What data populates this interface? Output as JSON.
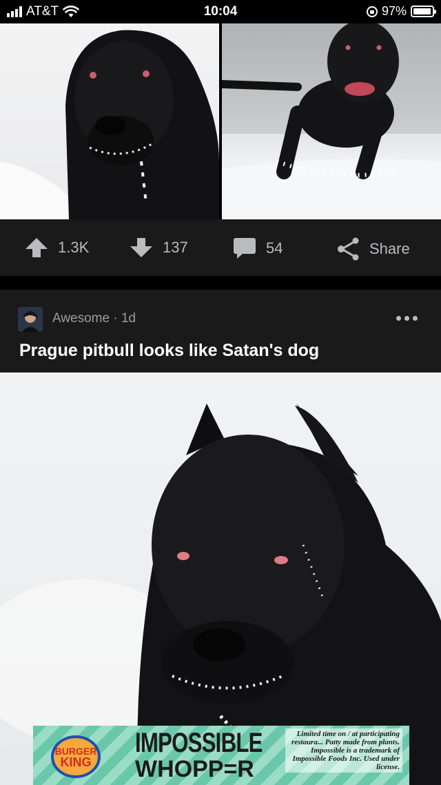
{
  "status_bar": {
    "carrier": "AT&T",
    "time": "10:04",
    "battery_percent": "97%",
    "battery_level": 0.97
  },
  "top_post": {
    "images": [
      "dog-closeup-in-snow",
      "dog-jumping-in-snow"
    ],
    "actions": {
      "upvotes": "1.3K",
      "downvotes": "137",
      "comments": "54",
      "share_label": "Share"
    }
  },
  "post": {
    "author": "Awesome",
    "age": "1d",
    "meta_separator": "·",
    "title": "Prague pitbull looks like Satan's dog",
    "image": "black-pitbull-in-snow"
  },
  "ad": {
    "brand": "BURGER KING",
    "brand_line1": "BURGER",
    "brand_line2": "KING",
    "headline": "IMPOSSIBLE",
    "subheadline": "WHOPP=R",
    "fine_print": "Limited time on / at participating restaura... Patty made from plants. Impossible is a trademark of Impossible Foods Inc. Used under license."
  },
  "colors": {
    "background": "#000000",
    "card": "#1a1a1b",
    "icon": "#b9bbbe",
    "title": "#ffffff",
    "ad_green": "#7bd0b4"
  }
}
